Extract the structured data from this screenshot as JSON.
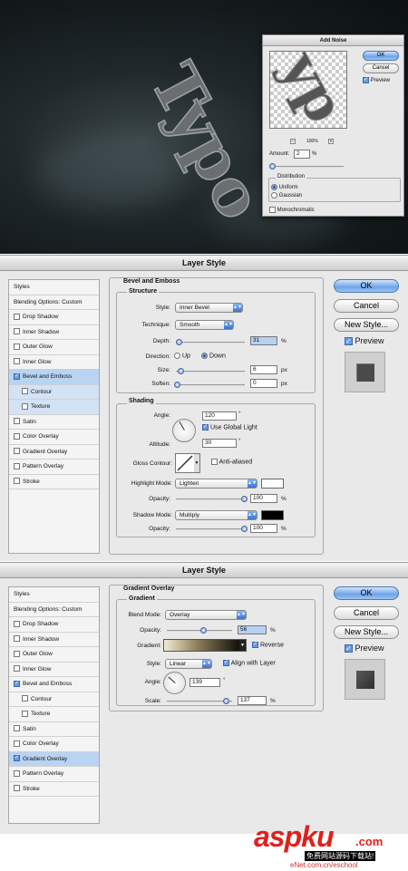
{
  "art": {
    "text": "Typo"
  },
  "add_noise": {
    "title": "Add Noise",
    "ok": "OK",
    "cancel": "Cancel",
    "preview": "Preview",
    "zoom": "100%",
    "amount_label": "Amount:",
    "amount_value": "2",
    "amount_unit": "%",
    "distribution_label": "Distribution",
    "uniform": "Uniform",
    "gaussian": "Gaussian",
    "monochromatic": "Monochromatic"
  },
  "style_list_1": {
    "header": "Styles",
    "items": [
      {
        "label": "Blending Options: Custom",
        "checkbox": false
      },
      {
        "label": "Drop Shadow",
        "checkbox": true,
        "checked": false
      },
      {
        "label": "Inner Shadow",
        "checkbox": true,
        "checked": false
      },
      {
        "label": "Outer Glow",
        "checkbox": true,
        "checked": false
      },
      {
        "label": "Inner Glow",
        "checkbox": true,
        "checked": false
      },
      {
        "label": "Bevel and Emboss",
        "checkbox": true,
        "checked": true,
        "selected": true
      },
      {
        "label": "Contour",
        "checkbox": true,
        "checked": false,
        "sub": true
      },
      {
        "label": "Texture",
        "checkbox": true,
        "checked": false,
        "sub": true
      },
      {
        "label": "Satin",
        "checkbox": true,
        "checked": false
      },
      {
        "label": "Color Overlay",
        "checkbox": true,
        "checked": false
      },
      {
        "label": "Gradient Overlay",
        "checkbox": true,
        "checked": false
      },
      {
        "label": "Pattern Overlay",
        "checkbox": true,
        "checked": false
      },
      {
        "label": "Stroke",
        "checkbox": true,
        "checked": false
      }
    ]
  },
  "style_list_2": {
    "header": "Styles",
    "items": [
      {
        "label": "Blending Options: Custom",
        "checkbox": false
      },
      {
        "label": "Drop Shadow",
        "checkbox": true,
        "checked": false
      },
      {
        "label": "Inner Shadow",
        "checkbox": true,
        "checked": false
      },
      {
        "label": "Outer Glow",
        "checkbox": true,
        "checked": false
      },
      {
        "label": "Inner Glow",
        "checkbox": true,
        "checked": false
      },
      {
        "label": "Bevel and Emboss",
        "checkbox": true,
        "checked": true
      },
      {
        "label": "Contour",
        "checkbox": true,
        "checked": false,
        "sub": true
      },
      {
        "label": "Texture",
        "checkbox": true,
        "checked": false,
        "sub": true
      },
      {
        "label": "Satin",
        "checkbox": true,
        "checked": false
      },
      {
        "label": "Color Overlay",
        "checkbox": true,
        "checked": false
      },
      {
        "label": "Gradient Overlay",
        "checkbox": true,
        "checked": true,
        "selected": true
      },
      {
        "label": "Pattern Overlay",
        "checkbox": true,
        "checked": false
      },
      {
        "label": "Stroke",
        "checkbox": true,
        "checked": false
      }
    ]
  },
  "bevel": {
    "window_title": "Layer Style",
    "section": "Bevel and Emboss",
    "structure": "Structure",
    "style_label": "Style:",
    "style_value": "Inner Bevel",
    "technique_label": "Technique:",
    "technique_value": "Smooth",
    "depth_label": "Depth:",
    "depth_value": "31",
    "depth_unit": "%",
    "direction_label": "Direction:",
    "up": "Up",
    "down": "Down",
    "size_label": "Size:",
    "size_value": "6",
    "size_unit": "px",
    "soften_label": "Soften:",
    "soften_value": "0",
    "soften_unit": "px",
    "shading": "Shading",
    "angle_label": "Angle:",
    "angle_value": "120",
    "degree": "°",
    "global_light": "Use Global Light",
    "altitude_label": "Altitude:",
    "altitude_value": "30",
    "gloss_label": "Gloss Contour:",
    "anti_aliased": "Anti-aliased",
    "highlight_label": "Highlight Mode:",
    "highlight_value": "Lighten",
    "h_opacity_label": "Opacity:",
    "h_opacity_value": "100",
    "pct": "%",
    "shadow_label": "Shadow Mode:",
    "shadow_value": "Multiply",
    "s_opacity_label": "Opacity:",
    "s_opacity_value": "100"
  },
  "gradient": {
    "window_title": "Layer Style",
    "section": "Gradient Overlay",
    "sub": "Gradient",
    "blend_label": "Blend Mode:",
    "blend_value": "Overlay",
    "opacity_label": "Opacity:",
    "opacity_value": "56",
    "pct": "%",
    "gradient_label": "Gradient:",
    "reverse": "Reverse",
    "style_label": "Style:",
    "style_value": "Linear",
    "align": "Align with Layer",
    "angle_label": "Angle:",
    "angle_value": "139",
    "degree": "°",
    "scale_label": "Scale:",
    "scale_value": "137"
  },
  "buttons": {
    "ok": "OK",
    "cancel": "Cancel",
    "new_style": "New Style...",
    "preview": "Preview"
  },
  "watermark": {
    "logo": "aspku",
    "suffix": ".com",
    "tagline": "免费网站源码下载站!",
    "site": "eNet.com.cn/eschool"
  },
  "colors": {
    "accent": "#6fa4e6",
    "selection": "#b9d4f3",
    "shadow_swatch": "#000000",
    "highlight_swatch": "#ffffff"
  }
}
